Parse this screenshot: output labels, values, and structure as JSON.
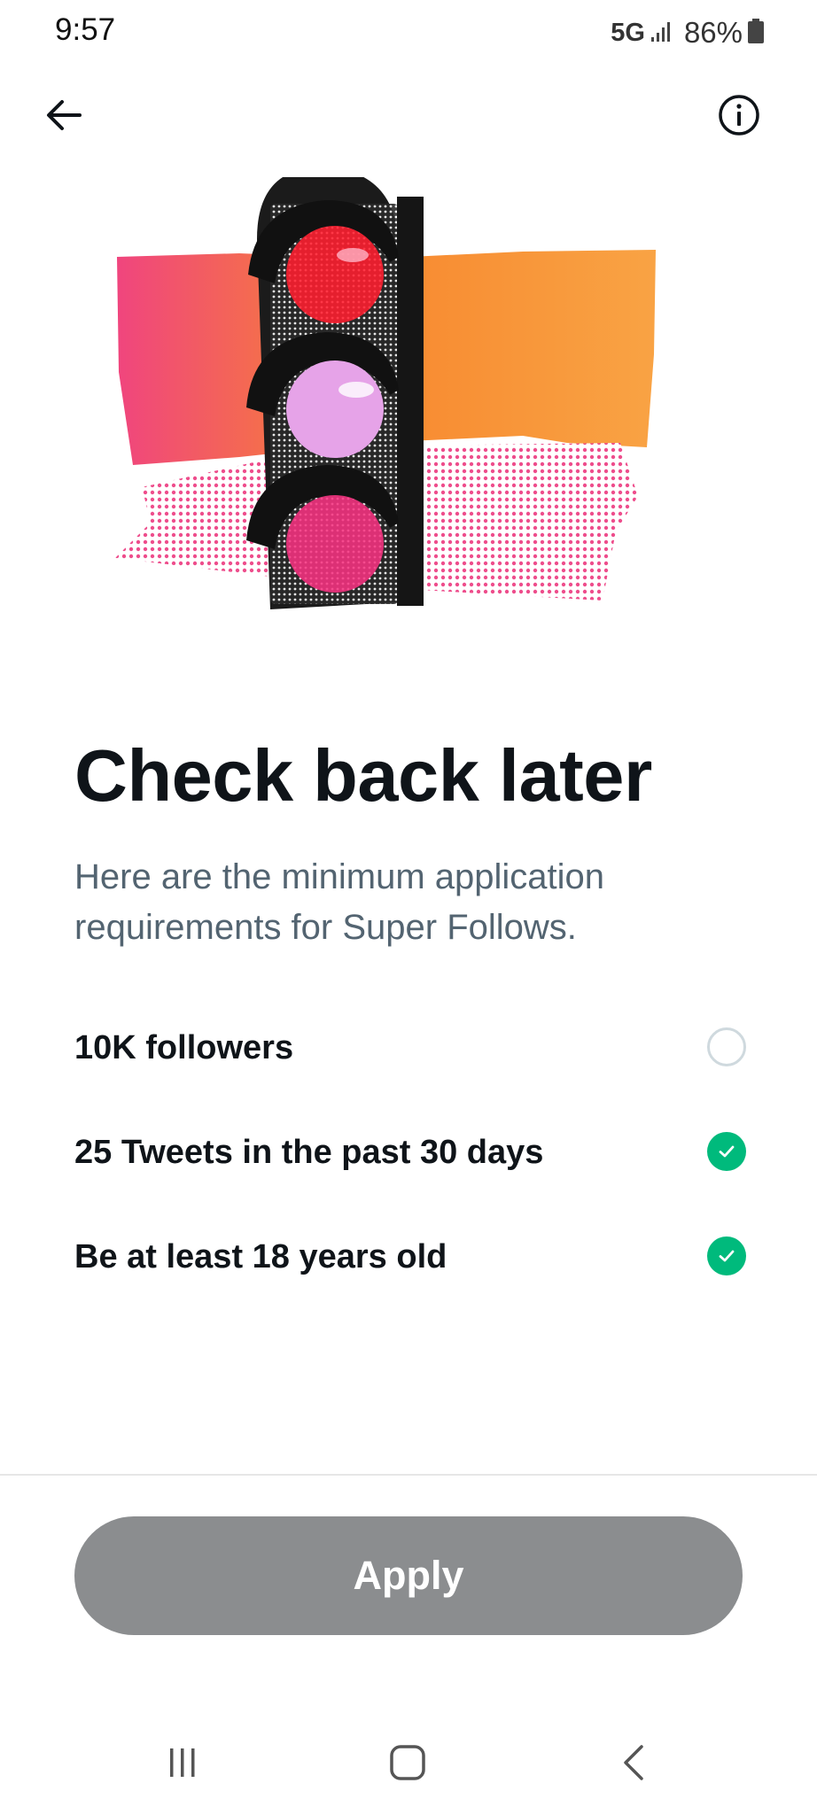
{
  "status_bar": {
    "time": "9:57",
    "network": "5G",
    "battery": "86%"
  },
  "header": {
    "back_icon": "arrow-left-icon",
    "info_icon": "info-circle-icon"
  },
  "hero": {
    "illustration": "traffic-light-illustration",
    "colors": {
      "pink": "#f0457e",
      "orange": "#f7922b",
      "red_light": "#ff1d2e",
      "lilac_light": "#e6a3e8",
      "magenta_light": "#f4317f"
    }
  },
  "main": {
    "title": "Check back later",
    "subtitle": "Here are the minimum application requirements for Super Follows.",
    "requirements": [
      {
        "label": "10K followers",
        "met": false
      },
      {
        "label": "25 Tweets in the past 30 days",
        "met": true
      },
      {
        "label": "Be at least 18 years old",
        "met": true
      }
    ]
  },
  "footer": {
    "apply_label": "Apply",
    "apply_disabled": true
  },
  "nav_bar": {
    "recent_icon": "recent-apps-icon",
    "home_icon": "home-icon",
    "back_icon": "back-chevron-icon"
  },
  "colors": {
    "check_green": "#00ba7c",
    "text_primary": "#0f1419",
    "text_secondary": "#536471",
    "button_disabled": "#8b8d8f"
  }
}
